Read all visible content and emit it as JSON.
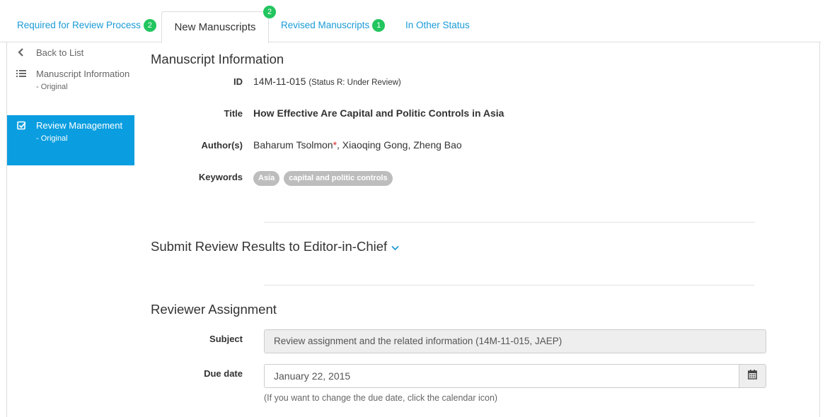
{
  "tabs": {
    "required": {
      "label": "Required for Review Process",
      "count": "2"
    },
    "new": {
      "label": "New Manuscripts",
      "count": "2"
    },
    "revised": {
      "label": "Revised Manuscripts",
      "count": "1"
    },
    "other": {
      "label": "In Other Status"
    }
  },
  "sidebar": {
    "back": {
      "label": "Back to List",
      "icon": "chevron-left-icon"
    },
    "items": [
      {
        "label": "Manuscript Information",
        "sub": "- Original",
        "icon": "list-icon"
      },
      {
        "label": "Review Management",
        "sub": "- Original",
        "icon": "check-square-icon"
      }
    ]
  },
  "manuscript": {
    "title": "Manuscript Information",
    "id_label": "ID",
    "id_value": "14M-11-015",
    "id_status": "(Status R: Under Review)",
    "title_label": "Title",
    "title_value": "How Effective Are Capital and Politic Controls in Asia",
    "authors_label": "Author(s)",
    "author_main": "Baharum Tsolmon",
    "author_mark": "*",
    "authors_rest": ", Xiaoqing Gong, Zheng Bao",
    "keywords_label": "Keywords",
    "keywords": [
      "Asia",
      "capital and politic controls"
    ]
  },
  "submit_section": {
    "title": "Submit Review Results to Editor-in-Chief"
  },
  "reviewer": {
    "title": "Reviewer Assignment",
    "subject_label": "Subject",
    "subject_value": "Review assignment and the related information (14M-11-015, JAEP)",
    "due_label": "Due date",
    "due_value": "January 22, 2015",
    "help": "(If you want to change the due date, click the calendar icon)"
  },
  "colors": {
    "accent": "#1a9bd7",
    "active_bg": "#0a9ee0",
    "badge": "#22c55e"
  }
}
